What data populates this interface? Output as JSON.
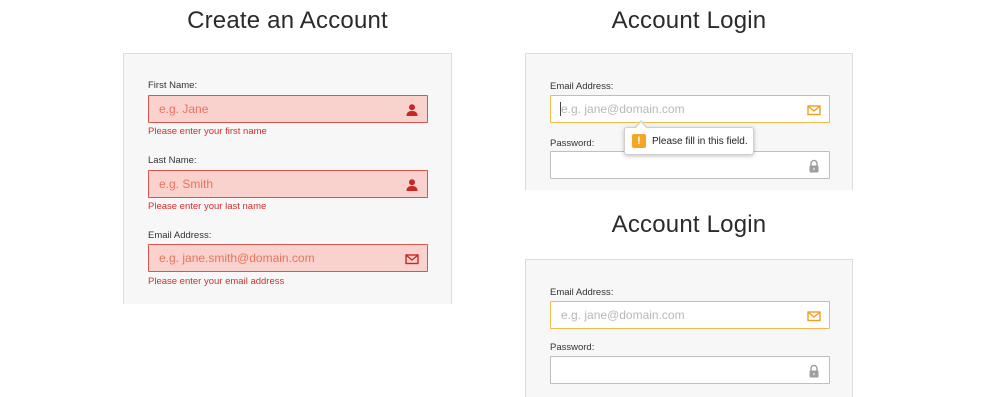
{
  "signup": {
    "title": "Create an Account",
    "fields": [
      {
        "label": "First Name:",
        "placeholder": "e.g. Jane",
        "icon": "user-icon",
        "error": "Please enter your first name"
      },
      {
        "label": "Last Name:",
        "placeholder": "e.g. Smith",
        "icon": "user-icon",
        "error": "Please enter your last name"
      },
      {
        "label": "Email Address:",
        "placeholder": "e.g. jane.smith@domain.com",
        "icon": "envelope-icon",
        "error": "Please enter your email address"
      }
    ]
  },
  "login_top": {
    "title": "Account Login",
    "email_label": "Email Address:",
    "email_placeholder": "e.g. jane@domain.com",
    "password_label": "Password:",
    "tooltip": "Please fill in this field."
  },
  "login_bottom": {
    "title": "Account Login",
    "email_label": "Email Address:",
    "email_placeholder": "e.g. jane@domain.com",
    "password_label": "Password:"
  },
  "colors": {
    "error_bg": "#fad2cd",
    "error_border": "#d9534f",
    "error_text": "#d32f2f",
    "focus_border": "#f5b94a",
    "warning": "#f5a623"
  }
}
